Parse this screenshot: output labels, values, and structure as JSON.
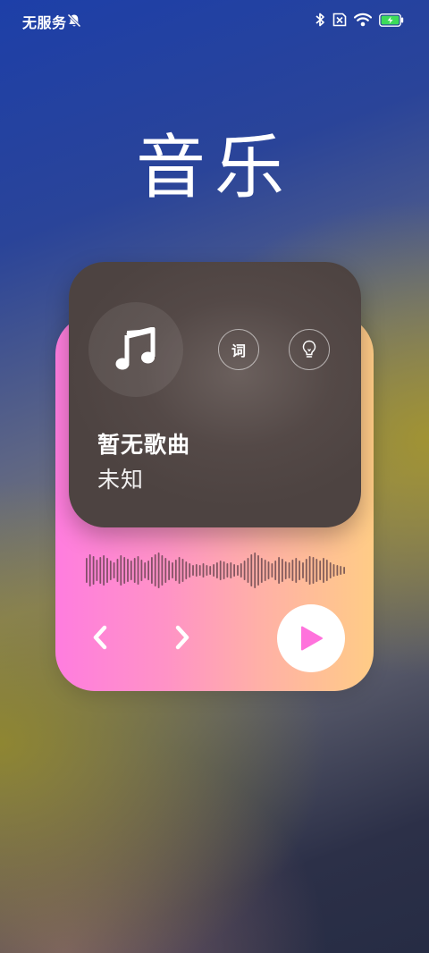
{
  "status_bar": {
    "carrier": "无服务",
    "icons": [
      "bell-off-icon",
      "bluetooth-icon",
      "sim-x-icon",
      "wifi-icon",
      "battery-charging-icon"
    ],
    "battery_color": "#3ddc5a"
  },
  "title": "音乐",
  "widget": {
    "song_title": "暂无歌曲",
    "artist": "未知",
    "lyrics_label": "词",
    "cover_icon": "music-note-icon",
    "bulb_icon": "lightbulb-icon",
    "play_color": "#ff72dc",
    "gradient": [
      "#ff7ddf",
      "#ffcc86"
    ]
  }
}
